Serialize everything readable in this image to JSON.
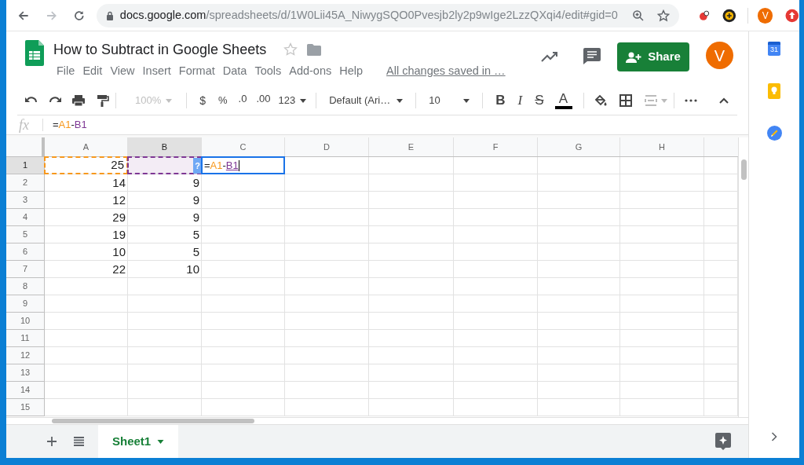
{
  "browser": {
    "url_domain": "docs.google.com",
    "url_path": "/spreadsheets/d/1W0Lii45A_NiwygSQO0Pvesjb2ly2p9wIge2LzzQXqi4/edit#gid=0",
    "profile_initial": "V"
  },
  "document": {
    "title": "How to Subtract in Google Sheets",
    "starred": false,
    "save_status": "All changes saved in …",
    "share_label": "Share",
    "avatar_initial": "V"
  },
  "menu": [
    "File",
    "Edit",
    "View",
    "Insert",
    "Format",
    "Data",
    "Tools",
    "Add-ons",
    "Help"
  ],
  "toolbar": {
    "zoom": "100%",
    "zoom_disabled": true,
    "currency": "$",
    "percent": "%",
    "decrease_decimals": ".0",
    "increase_decimals": ".00",
    "number_format": "123",
    "font": "Default (Ari…",
    "font_size": "10",
    "bold": "B",
    "italic": "I",
    "strikethrough": "S",
    "text_color_letter": "A"
  },
  "formula_bar": {
    "fx": "fx",
    "parts": [
      {
        "text": "="
      },
      {
        "text": "A1",
        "color": "#f7981d"
      },
      {
        "text": "-"
      },
      {
        "text": "B1",
        "color": "#7e3794"
      }
    ]
  },
  "grid": {
    "columns": [
      {
        "label": "A",
        "selected": false
      },
      {
        "label": "B",
        "selected": true
      },
      {
        "label": "C",
        "selected": false
      },
      {
        "label": "D",
        "selected": false
      },
      {
        "label": "E",
        "selected": false
      },
      {
        "label": "F",
        "selected": false
      },
      {
        "label": "G",
        "selected": false
      },
      {
        "label": "H",
        "selected": false
      }
    ],
    "rows": [
      {
        "header": "1",
        "selected": true,
        "cells": [
          {
            "value": "25",
            "color": "#f7981d"
          },
          {
            "color": "#7e3794",
            "badge": "?"
          },
          {
            "kind": "editor",
            "parts": [
              {
                "text": "="
              },
              {
                "text": "A1",
                "color": "#f7981d"
              },
              {
                "text": "-"
              },
              {
                "text": "B1",
                "color": "#7e3794",
                "underline": true
              }
            ]
          }
        ]
      },
      {
        "header": "2",
        "selected": false,
        "cells": [
          {
            "value": "14"
          },
          {
            "value": "9"
          }
        ]
      },
      {
        "header": "3",
        "selected": false,
        "cells": [
          {
            "value": "12"
          },
          {
            "value": "9"
          }
        ]
      },
      {
        "header": "4",
        "selected": false,
        "cells": [
          {
            "value": "29"
          },
          {
            "value": "9"
          }
        ]
      },
      {
        "header": "5",
        "selected": false,
        "cells": [
          {
            "value": "19"
          },
          {
            "value": "5"
          }
        ]
      },
      {
        "header": "6",
        "selected": false,
        "cells": [
          {
            "value": "10"
          },
          {
            "value": "5"
          }
        ]
      },
      {
        "header": "7",
        "selected": false,
        "cells": [
          {
            "value": "22"
          },
          {
            "value": "10"
          }
        ]
      },
      {
        "header": "8",
        "selected": false,
        "cells": []
      },
      {
        "header": "9",
        "selected": false,
        "cells": []
      },
      {
        "header": "10",
        "selected": false,
        "cells": []
      },
      {
        "header": "11",
        "selected": false,
        "cells": []
      },
      {
        "header": "12",
        "selected": false,
        "cells": []
      },
      {
        "header": "13",
        "selected": false,
        "cells": []
      },
      {
        "header": "14",
        "selected": false,
        "cells": []
      },
      {
        "header": "15",
        "selected": false,
        "cells": []
      }
    ]
  },
  "sheet_tabs": [
    {
      "label": "Sheet1",
      "selected": true
    }
  ],
  "side_panel": {
    "calendar_day": "31"
  }
}
